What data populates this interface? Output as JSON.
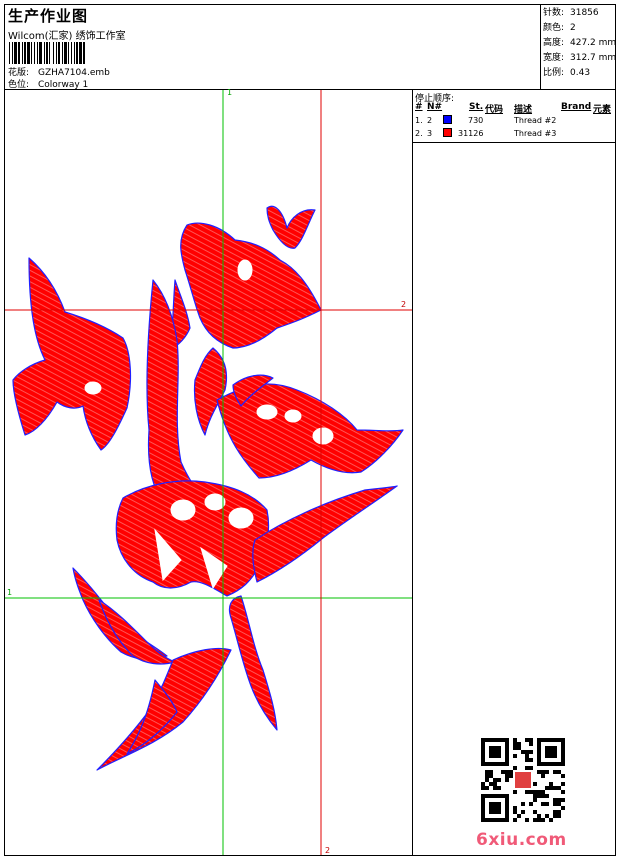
{
  "header": {
    "title": "生产作业图",
    "company": "Wilcom(汇家) 绣饰工作室",
    "pattern_label": "花版:",
    "pattern_value": "GZHA7104.emb",
    "colorway_label": "色位:",
    "colorway_value": "Colorway 1"
  },
  "stats": [
    {
      "label": "针数:",
      "value": "31856"
    },
    {
      "label": "颜色:",
      "value": "2"
    },
    {
      "label": "高度:",
      "value": "427.2 mm"
    },
    {
      "label": "宽度:",
      "value": "312.7 mm"
    },
    {
      "label": "比例:",
      "value": "0.43"
    }
  ],
  "stop_sequence": {
    "title": "停止顺序:",
    "columns": [
      "#",
      "N#",
      "St.",
      "代码",
      "描述",
      "Brand",
      "元素"
    ],
    "rows": [
      {
        "index": "1.",
        "n": "2",
        "color": "#0000ff",
        "code": "730",
        "desc": "Thread #2"
      },
      {
        "index": "2.",
        "n": "3",
        "color": "#ff0000",
        "code": "31126",
        "desc": "Thread #3"
      }
    ]
  },
  "design": {
    "guide_labels": {
      "green_top": "1",
      "green_left": "1",
      "red_right": "2",
      "red_bottom": "2"
    },
    "fill_color": "#ff0000",
    "outline_color": "#2020ff",
    "guide_green": "#00c000",
    "guide_red": "#e00000"
  },
  "watermark": "6xiu.com"
}
